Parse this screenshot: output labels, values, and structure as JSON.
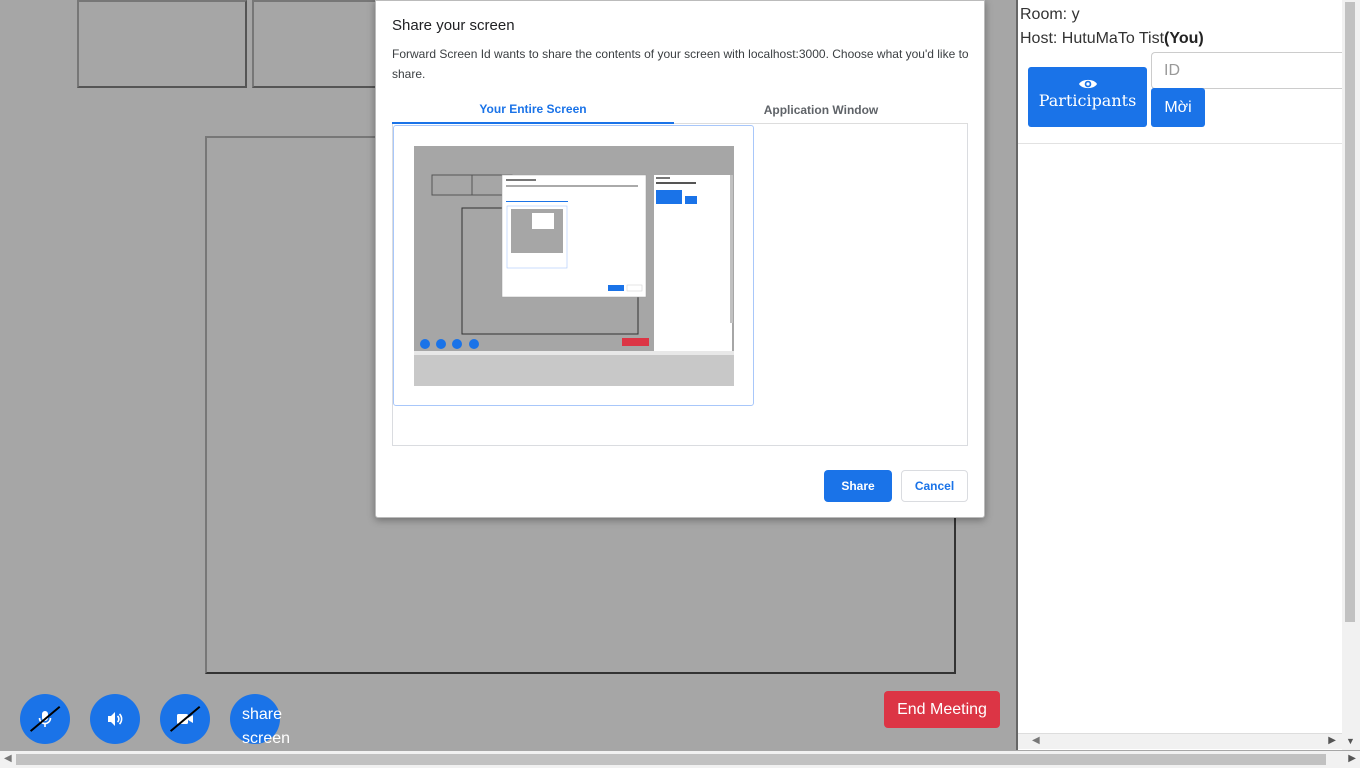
{
  "room": {
    "label": "Room: y"
  },
  "host": {
    "prefix": "Host: HutuMaTo Tist",
    "you": "(You)"
  },
  "participants_button": {
    "label": "Participants",
    "icon": "eye-icon"
  },
  "invite": {
    "placeholder": "ID",
    "button_label": "Mời"
  },
  "controls": {
    "mic_icon": "microphone-off-icon",
    "speaker_icon": "speaker-icon",
    "camera_icon": "camera-off-icon",
    "share_label_1": "share",
    "share_label_2": "screen",
    "end_label": "End Meeting"
  },
  "dialog": {
    "title": "Share your screen",
    "description": "Forward Screen Id wants to share the contents of your screen with localhost:3000. Choose what you'd like to share.",
    "tabs": [
      "Your Entire Screen",
      "Application Window"
    ],
    "share_label": "Share",
    "cancel_label": "Cancel"
  },
  "colors": {
    "accent": "#1a73e8",
    "danger": "#dc3545",
    "backdrop": "#a6a6a6"
  }
}
